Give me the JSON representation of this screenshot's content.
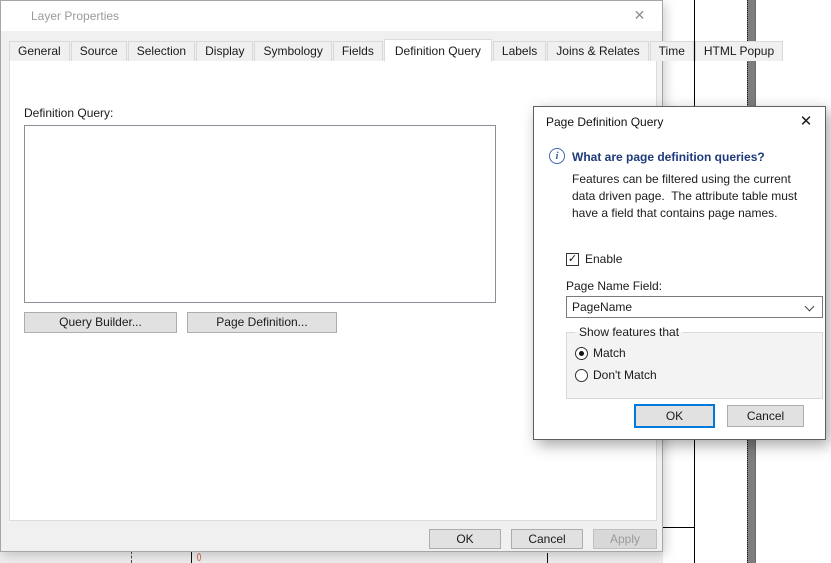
{
  "icons": {
    "close": "✕",
    "check": "✓",
    "info": "i"
  },
  "colors": {
    "accent": "#0078d7",
    "help_heading": "#1e3a7a",
    "inactive_title": "#9b9b9b"
  },
  "background": {
    "map_glyph": "⟨⟩"
  },
  "layer_properties": {
    "title": "Layer Properties",
    "tabs": [
      "General",
      "Source",
      "Selection",
      "Display",
      "Symbology",
      "Fields",
      "Definition Query",
      "Labels",
      "Joins & Relates",
      "Time",
      "HTML Popup"
    ],
    "selected_tab": "Definition Query",
    "definition_query_label": "Definition Query:",
    "query_value": "",
    "buttons": {
      "query_builder": "Query Builder...",
      "page_definition": "Page Definition...",
      "ok": "OK",
      "cancel": "Cancel",
      "apply": "Apply"
    }
  },
  "page_definition_query": {
    "title": "Page Definition Query",
    "help_heading": "What are page definition queries?",
    "help_body_lines": [
      "Features can be filtered using the current",
      "data driven page.  The attribute table must",
      "have a field that contains page names."
    ],
    "enable_label": "Enable",
    "enable_checked": true,
    "page_name_field_label": "Page Name Field:",
    "page_name_value": "PageName",
    "show_features_label": "Show features that",
    "radio_options": [
      {
        "label": "Match",
        "selected": true
      },
      {
        "label": "Don't Match",
        "selected": false
      }
    ],
    "buttons": {
      "ok": "OK",
      "cancel": "Cancel"
    }
  }
}
